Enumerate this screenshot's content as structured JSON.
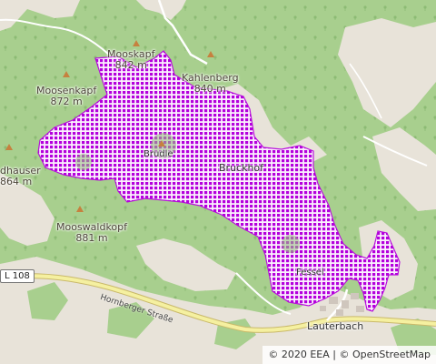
{
  "peaks": [
    {
      "name": "Mooskapf",
      "elev": "842 m"
    },
    {
      "name": "Kahlenberg",
      "elev": "840 m"
    },
    {
      "name": "Moosenkapf",
      "elev": "872 m"
    },
    {
      "name": "dhauser",
      "elev": "864 m"
    },
    {
      "name": "Mooswaldkopf",
      "elev": "881 m"
    }
  ],
  "places": [
    "Bruckhof",
    "Lauterbach",
    "Brudle",
    "Fessel"
  ],
  "road_shield": "L 108",
  "road_name": "Hornberger Straße",
  "attribution": {
    "copyright_sign": "©",
    "eea": "2020 EEA",
    "separator": "|",
    "osm": "OpenStreetMap"
  },
  "colors": {
    "forest": "#a8cf8e",
    "forest_dark": "#96c47c",
    "open_land": "#e8e3d9",
    "protected_area": "#b400dc",
    "road": "#f5f0a0"
  }
}
